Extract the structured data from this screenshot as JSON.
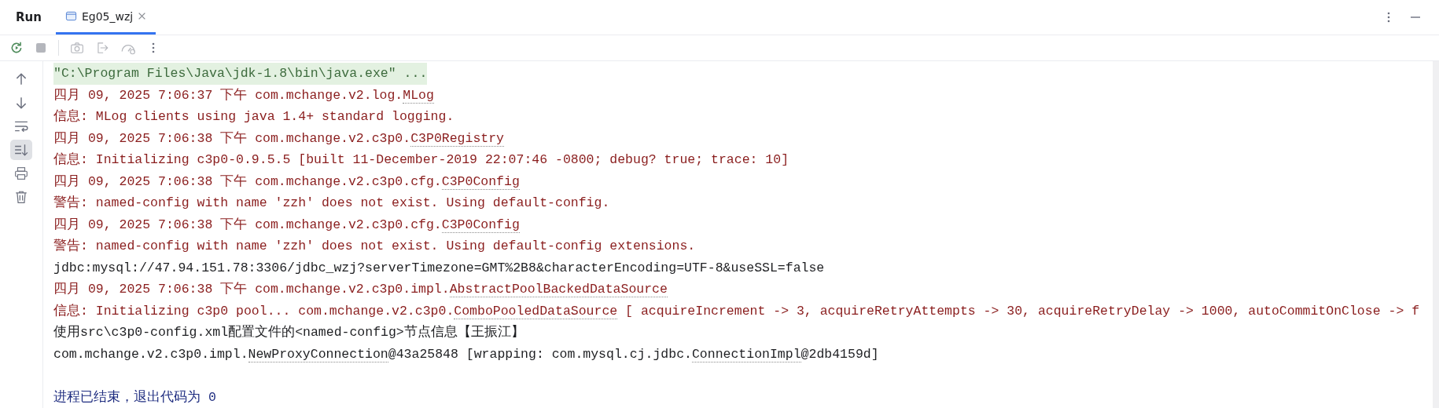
{
  "panel": {
    "title": "Run",
    "tabs": [
      {
        "label": "Eg05_wzj",
        "selected": true
      }
    ]
  },
  "console": {
    "lines": [
      {
        "kind": "command",
        "parts": [
          {
            "text": "\"C:\\Program Files\\Java\\jdk-1.8\\bin\\java.exe\" ...",
            "link": false
          }
        ]
      },
      {
        "kind": "error",
        "parts": [
          {
            "text": "四月 09, 2025 7:06:37 下午 com.mchange.v2.log.",
            "link": false
          },
          {
            "text": "MLog",
            "link": true
          }
        ]
      },
      {
        "kind": "error",
        "parts": [
          {
            "text": "信息: MLog clients using java 1.4+ standard logging.",
            "link": false
          }
        ]
      },
      {
        "kind": "error",
        "parts": [
          {
            "text": "四月 09, 2025 7:06:38 下午 com.mchange.v2.c3p0.",
            "link": false
          },
          {
            "text": "C3P0Registry",
            "link": true
          }
        ]
      },
      {
        "kind": "error",
        "parts": [
          {
            "text": "信息: Initializing c3p0-0.9.5.5 [built 11-December-2019 22:07:46 -0800; debug? true; trace: 10]",
            "link": false
          }
        ]
      },
      {
        "kind": "error",
        "parts": [
          {
            "text": "四月 09, 2025 7:06:38 下午 com.mchange.v2.c3p0.cfg.",
            "link": false
          },
          {
            "text": "C3P0Config",
            "link": true
          }
        ]
      },
      {
        "kind": "error",
        "parts": [
          {
            "text": "警告: named-config with name 'zzh' does not exist. Using default-config.",
            "link": false
          }
        ]
      },
      {
        "kind": "error",
        "parts": [
          {
            "text": "四月 09, 2025 7:06:38 下午 com.mchange.v2.c3p0.cfg.",
            "link": false
          },
          {
            "text": "C3P0Config",
            "link": true
          }
        ]
      },
      {
        "kind": "error",
        "parts": [
          {
            "text": "警告: named-config with name 'zzh' does not exist. Using default-config extensions.",
            "link": false
          }
        ]
      },
      {
        "kind": "output",
        "parts": [
          {
            "text": "jdbc:mysql://47.94.151.78:3306/jdbc_wzj?serverTimezone=GMT%2B8&characterEncoding=UTF-8&useSSL=false",
            "link": false
          }
        ]
      },
      {
        "kind": "error",
        "parts": [
          {
            "text": "四月 09, 2025 7:06:38 下午 com.mchange.v2.c3p0.impl.",
            "link": false
          },
          {
            "text": "AbstractPoolBackedDataSource",
            "link": true
          }
        ]
      },
      {
        "kind": "error",
        "parts": [
          {
            "text": "信息: Initializing c3p0 pool... com.mchange.v2.c3p0.",
            "link": false
          },
          {
            "text": "ComboPooledDataSource",
            "link": true
          },
          {
            "text": " [ acquireIncrement -> 3, acquireRetryAttempts -> 30, acquireRetryDelay -> 1000, autoCommitOnClose -> f",
            "link": false
          }
        ]
      },
      {
        "kind": "output",
        "parts": [
          {
            "text": "使用src\\c3p0-config.xml配置文件的<named-config>节点信息【王振江】",
            "link": false
          }
        ]
      },
      {
        "kind": "output",
        "parts": [
          {
            "text": "com.mchange.v2.c3p0.impl.",
            "link": false
          },
          {
            "text": "NewProxyConnection",
            "link": true
          },
          {
            "text": "@43a25848 [wrapping: com.mysql.cj.jdbc.",
            "link": false
          },
          {
            "text": "ConnectionImpl",
            "link": true
          },
          {
            "text": "@2db4159d]",
            "link": false
          }
        ]
      },
      {
        "kind": "blank"
      },
      {
        "kind": "exit",
        "parts": [
          {
            "text": "进程已结束，退出代码为 0",
            "link": false
          }
        ]
      }
    ]
  }
}
